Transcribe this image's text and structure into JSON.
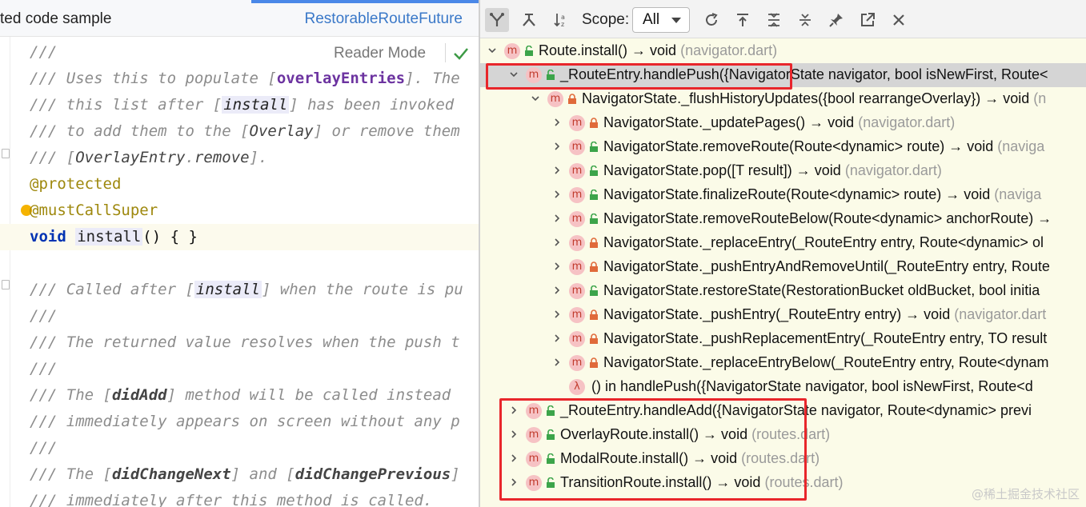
{
  "editor": {
    "tab_left": "ted code sample",
    "tab_right": "RestorableRouteFuture",
    "reader_mode": "Reader Mode",
    "lines": {
      "l1": "///",
      "l2a": "/// Uses this to populate [",
      "l2b": "overlayEntries",
      "l2c": "]. The",
      "l3a": "/// this list after [",
      "l3b": "install",
      "l3c": "] has been invoked",
      "l4a": "/// to add them to the [",
      "l4b": "Overlay",
      "l4c": "] or remove them",
      "l5a": "/// [",
      "l5b": "OverlayEntry",
      "l5c": ".",
      "l5d": "remove",
      "l5e": "].",
      "l6": "@protected",
      "l7": "@mustCallSuper",
      "l8a": "void",
      "l8b": "install",
      "l8c": "() { }",
      "l10a": "/// Called after [",
      "l10b": "install",
      "l10c": "] when the route is pu",
      "l11": "///",
      "l12": "/// The returned value resolves when the push t",
      "l13": "///",
      "l14a": "/// The [",
      "l14b": "didAdd",
      "l14c": "] method will be called instead",
      "l15": "/// immediately appears on screen without any p",
      "l16": "///",
      "l17a": "/// The [",
      "l17b": "didChangeNext",
      "l17c": "] and [",
      "l17d": "didChangePrevious",
      "l17e": "]",
      "l18": "/// immediately after this method is called."
    }
  },
  "toolbar": {
    "scope_label": "Scope:",
    "scope_value": "All",
    "icons": [
      "hierarchy-icon",
      "callees-icon",
      "sort-alpha-icon",
      "refresh-icon",
      "export-icon",
      "expand-all-icon",
      "collapse-all-icon",
      "pin-icon",
      "open-in-window-icon",
      "close-icon"
    ]
  },
  "tree": [
    {
      "name": "Route.install() → void",
      "file": "(navigator.dart)",
      "access": "public",
      "badge": "m",
      "expanded": true
    },
    {
      "name": "_RouteEntry.handlePush({NavigatorState navigator, bool isNewFirst, Route<",
      "file": "",
      "access": "public",
      "badge": "m",
      "expanded": true,
      "selected": true
    },
    {
      "name": "NavigatorState._flushHistoryUpdates({bool rearrangeOverlay}) → void",
      "file": "(n",
      "access": "private",
      "badge": "m",
      "expanded": true
    },
    {
      "name": "NavigatorState._updatePages() → void",
      "file": "(navigator.dart)",
      "access": "private",
      "badge": "m"
    },
    {
      "name": "NavigatorState.removeRoute(Route<dynamic> route) → void",
      "file": "(naviga",
      "access": "public",
      "badge": "m"
    },
    {
      "name": "NavigatorState.pop([T result]) → void",
      "file": "(navigator.dart)",
      "access": "public",
      "badge": "m"
    },
    {
      "name": "NavigatorState.finalizeRoute(Route<dynamic> route) → void",
      "file": "(naviga",
      "access": "public",
      "badge": "m"
    },
    {
      "name": "NavigatorState.removeRouteBelow(Route<dynamic> anchorRoute) →",
      "file": "",
      "access": "public",
      "badge": "m"
    },
    {
      "name": "NavigatorState._replaceEntry(_RouteEntry entry, Route<dynamic> ol",
      "file": "",
      "access": "private",
      "badge": "m"
    },
    {
      "name": "NavigatorState._pushEntryAndRemoveUntil(_RouteEntry entry, Route",
      "file": "",
      "access": "private",
      "badge": "m"
    },
    {
      "name": "NavigatorState.restoreState(RestorationBucket oldBucket, bool initia",
      "file": "",
      "access": "public",
      "badge": "m"
    },
    {
      "name": "NavigatorState._pushEntry(_RouteEntry entry) → void",
      "file": "(navigator.dart",
      "access": "private",
      "badge": "m"
    },
    {
      "name": "NavigatorState._pushReplacementEntry(_RouteEntry entry, TO result",
      "file": "",
      "access": "private",
      "badge": "m"
    },
    {
      "name": "NavigatorState._replaceEntryBelow(_RouteEntry entry, Route<dynam",
      "file": "",
      "access": "private",
      "badge": "m"
    },
    {
      "name": "() in handlePush({NavigatorState navigator, bool isNewFirst, Route<d",
      "file": "",
      "access": "none",
      "badge": "λ"
    },
    {
      "name": "_RouteEntry.handleAdd({NavigatorState navigator, Route<dynamic> previ",
      "file": "",
      "access": "public",
      "badge": "m"
    },
    {
      "name": "OverlayRoute.install() → void",
      "file": "(routes.dart)",
      "access": "public",
      "badge": "m"
    },
    {
      "name": "ModalRoute.install() → void",
      "file": "(routes.dart)",
      "access": "public",
      "badge": "m"
    },
    {
      "name": "TransitionRoute.install() → void",
      "file": "(routes.dart)",
      "access": "public",
      "badge": "m"
    }
  ],
  "watermark": "@稀土掘金技术社区",
  "colors": {
    "highlight_box": "#e8262b",
    "panel_bg": "#fbfbe8",
    "selected_row": "#d5d5d5"
  }
}
